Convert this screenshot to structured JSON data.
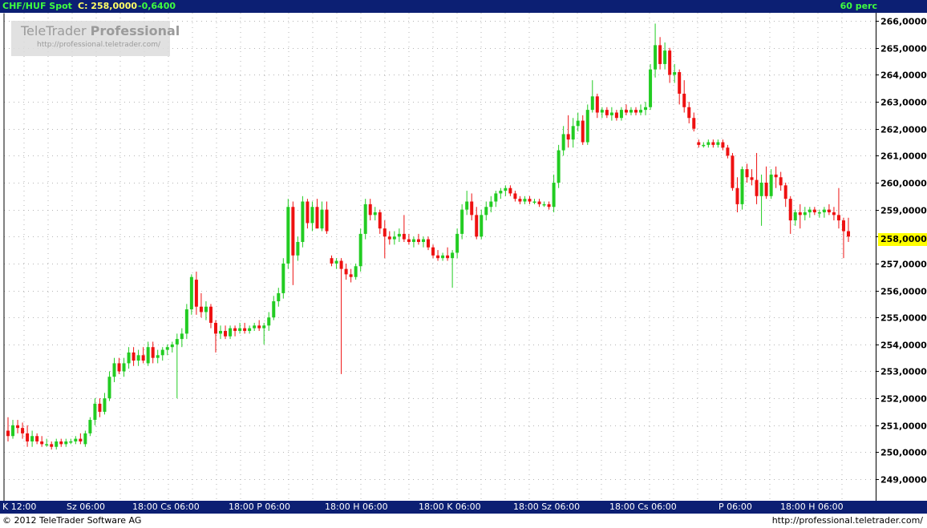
{
  "header": {
    "symbol": "CHF/HUF Spot",
    "close_label": "C: 258,0000",
    "change": "-0,6400",
    "interval": "60 perc"
  },
  "watermark": {
    "brand_light": "TeleTrader",
    "brand_bold": "Professional",
    "url": "http://professional.teletrader.com/"
  },
  "footer": {
    "copyright": "© 2012 TeleTrader Software AG",
    "url": "http://professional.teletrader.com/"
  },
  "colors": {
    "up": "#22cc22",
    "down": "#ee1111",
    "grid": "#b4b4b4",
    "header_bg": "#0c1f73",
    "last_price_bg": "#ffff00"
  },
  "chart_data": {
    "type": "candlestick",
    "y_axis_ticks": [
      "266,0000",
      "265,0000",
      "264,0000",
      "263,0000",
      "262,0000",
      "261,0000",
      "260,0000",
      "259,0000",
      "258,0000",
      "257,0000",
      "256,0000",
      "255,0000",
      "254,0000",
      "253,0000",
      "252,0000",
      "251,0000",
      "250,0000",
      "249,0000"
    ],
    "ylim": [
      248.2,
      266.3
    ],
    "last_price": 258.0,
    "last_price_label": "258,0000",
    "x_axis_ticks": [
      "K 12:00",
      "Sz 06:00",
      "18:00 Cs 06:00",
      "18:00 P 06:00",
      "18:00 H 06:00",
      "18:00 K 06:00",
      "18:00 Sz 06:00",
      "18:00 Cs 06:00",
      "P 06:00",
      "18:00 H 06:00"
    ],
    "candles": [
      [
        250.8,
        251.3,
        250.4,
        250.6
      ],
      [
        250.6,
        251.2,
        250.5,
        251.0
      ],
      [
        251.0,
        251.2,
        250.7,
        250.9
      ],
      [
        250.9,
        251.1,
        250.5,
        250.7
      ],
      [
        250.7,
        251.0,
        250.2,
        250.4
      ],
      [
        250.4,
        250.8,
        250.2,
        250.6
      ],
      [
        250.6,
        250.7,
        250.3,
        250.4
      ],
      [
        250.4,
        250.6,
        250.2,
        250.3
      ],
      [
        250.3,
        250.5,
        250.2,
        250.3
      ],
      [
        250.3,
        250.4,
        250.1,
        250.2
      ],
      [
        250.2,
        250.5,
        250.1,
        250.4
      ],
      [
        250.4,
        250.5,
        250.2,
        250.3
      ],
      [
        250.3,
        250.5,
        250.2,
        250.4
      ],
      [
        250.4,
        250.5,
        250.3,
        250.4
      ],
      [
        250.4,
        250.6,
        250.3,
        250.5
      ],
      [
        250.5,
        250.7,
        250.3,
        250.4
      ],
      [
        250.3,
        250.8,
        250.2,
        250.7
      ],
      [
        250.7,
        251.3,
        250.6,
        251.2
      ],
      [
        251.2,
        252.0,
        251.0,
        251.8
      ],
      [
        251.8,
        252.0,
        251.3,
        251.5
      ],
      [
        251.5,
        252.2,
        251.4,
        252.0
      ],
      [
        252.0,
        253.0,
        251.9,
        252.8
      ],
      [
        252.8,
        253.5,
        252.6,
        253.3
      ],
      [
        253.3,
        253.5,
        252.9,
        253.0
      ],
      [
        253.0,
        253.5,
        252.8,
        253.3
      ],
      [
        253.3,
        253.9,
        253.1,
        253.7
      ],
      [
        253.7,
        253.9,
        253.2,
        253.4
      ],
      [
        253.4,
        253.8,
        253.2,
        253.6
      ],
      [
        253.6,
        253.9,
        253.3,
        253.4
      ],
      [
        253.3,
        254.1,
        253.2,
        253.9
      ],
      [
        253.9,
        254.1,
        253.3,
        253.5
      ],
      [
        253.5,
        253.8,
        253.3,
        253.6
      ],
      [
        253.6,
        253.9,
        253.4,
        253.8
      ],
      [
        253.8,
        254.0,
        253.6,
        253.9
      ],
      [
        253.9,
        254.1,
        253.7,
        254.0
      ],
      [
        254.0,
        254.4,
        252.0,
        254.2
      ],
      [
        254.2,
        254.6,
        253.9,
        254.4
      ],
      [
        254.4,
        255.5,
        254.2,
        255.3
      ],
      [
        255.3,
        256.6,
        255.1,
        256.5
      ],
      [
        256.4,
        256.7,
        255.1,
        255.4
      ],
      [
        255.4,
        255.9,
        255.0,
        255.2
      ],
      [
        255.2,
        255.6,
        254.9,
        255.4
      ],
      [
        255.4,
        255.5,
        254.6,
        254.8
      ],
      [
        254.8,
        254.9,
        253.7,
        254.4
      ],
      [
        254.4,
        254.7,
        254.2,
        254.5
      ],
      [
        254.5,
        254.7,
        254.2,
        254.3
      ],
      [
        254.3,
        254.7,
        254.2,
        254.6
      ],
      [
        254.6,
        254.7,
        254.3,
        254.5
      ],
      [
        254.5,
        254.8,
        254.4,
        254.6
      ],
      [
        254.6,
        254.8,
        254.4,
        254.5
      ],
      [
        254.5,
        254.7,
        254.4,
        254.6
      ],
      [
        254.6,
        254.8,
        254.5,
        254.7
      ],
      [
        254.7,
        254.9,
        254.5,
        254.6
      ],
      [
        254.6,
        254.8,
        254.0,
        254.7
      ],
      [
        254.7,
        255.2,
        254.5,
        255.0
      ],
      [
        255.0,
        255.8,
        254.9,
        255.6
      ],
      [
        255.6,
        256.1,
        255.4,
        255.9
      ],
      [
        255.9,
        257.2,
        255.7,
        257.0
      ],
      [
        257.0,
        259.4,
        256.8,
        259.1
      ],
      [
        259.1,
        259.3,
        256.2,
        257.3
      ],
      [
        257.3,
        258.0,
        257.1,
        257.8
      ],
      [
        257.8,
        259.5,
        257.6,
        259.3
      ],
      [
        259.3,
        259.4,
        258.3,
        258.5
      ],
      [
        258.5,
        259.3,
        258.2,
        259.1
      ],
      [
        259.1,
        259.4,
        258.3,
        258.3
      ],
      [
        258.3,
        259.3,
        258.2,
        259.0
      ],
      [
        259.0,
        259.3,
        258.1,
        258.2
      ],
      [
        257.2,
        257.3,
        256.9,
        257.0
      ],
      [
        257.0,
        257.2,
        256.8,
        257.1
      ],
      [
        257.1,
        257.2,
        252.9,
        256.8
      ],
      [
        256.8,
        257.0,
        256.4,
        256.6
      ],
      [
        256.6,
        256.8,
        256.3,
        256.5
      ],
      [
        256.5,
        257.0,
        256.4,
        256.9
      ],
      [
        256.9,
        258.3,
        256.7,
        258.1
      ],
      [
        258.1,
        259.4,
        257.9,
        259.2
      ],
      [
        259.2,
        259.4,
        258.6,
        258.8
      ],
      [
        258.8,
        259.1,
        258.6,
        258.9
      ],
      [
        258.9,
        259.0,
        258.1,
        258.3
      ],
      [
        258.3,
        258.6,
        257.2,
        258.0
      ],
      [
        258.0,
        258.2,
        257.7,
        257.9
      ],
      [
        257.9,
        258.2,
        257.7,
        258.0
      ],
      [
        258.0,
        258.3,
        257.8,
        258.1
      ],
      [
        258.1,
        258.8,
        257.8,
        257.9
      ],
      [
        257.9,
        258.1,
        257.7,
        257.8
      ],
      [
        257.8,
        258.0,
        257.6,
        257.9
      ],
      [
        257.9,
        258.1,
        257.7,
        257.8
      ],
      [
        257.8,
        258.0,
        257.6,
        257.9
      ],
      [
        257.9,
        258.0,
        257.5,
        257.6
      ],
      [
        257.6,
        257.7,
        257.2,
        257.3
      ],
      [
        257.3,
        257.5,
        257.1,
        257.2
      ],
      [
        257.2,
        257.4,
        257.1,
        257.3
      ],
      [
        257.3,
        257.6,
        257.1,
        257.2
      ],
      [
        257.2,
        257.5,
        256.1,
        257.4
      ],
      [
        257.4,
        258.3,
        257.2,
        258.1
      ],
      [
        258.1,
        259.2,
        257.9,
        259.0
      ],
      [
        259.0,
        259.7,
        258.8,
        259.3
      ],
      [
        259.3,
        259.6,
        258.6,
        258.8
      ],
      [
        258.8,
        259.1,
        257.9,
        258.0
      ],
      [
        258.0,
        259.0,
        257.9,
        258.8
      ],
      [
        258.8,
        259.3,
        258.6,
        259.1
      ],
      [
        259.1,
        259.5,
        258.9,
        259.3
      ],
      [
        259.3,
        259.7,
        259.1,
        259.6
      ],
      [
        259.6,
        259.8,
        259.4,
        259.7
      ],
      [
        259.7,
        259.9,
        259.5,
        259.8
      ],
      [
        259.8,
        259.9,
        259.5,
        259.6
      ],
      [
        259.6,
        259.7,
        259.3,
        259.4
      ],
      [
        259.4,
        259.5,
        259.2,
        259.3
      ],
      [
        259.3,
        259.5,
        259.2,
        259.4
      ],
      [
        259.4,
        259.5,
        259.2,
        259.3
      ],
      [
        259.3,
        259.4,
        259.2,
        259.3
      ],
      [
        259.3,
        259.4,
        259.1,
        259.2
      ],
      [
        259.2,
        259.3,
        259.1,
        259.2
      ],
      [
        259.2,
        259.3,
        259.0,
        259.1
      ],
      [
        259.1,
        260.3,
        258.9,
        260.0
      ],
      [
        260.0,
        261.4,
        259.8,
        261.2
      ],
      [
        261.2,
        262.1,
        261.0,
        261.8
      ],
      [
        261.8,
        262.5,
        261.3,
        261.6
      ],
      [
        261.6,
        262.4,
        261.3,
        262.1
      ],
      [
        262.1,
        262.6,
        261.9,
        262.3
      ],
      [
        262.3,
        262.5,
        261.4,
        261.5
      ],
      [
        261.5,
        262.9,
        261.4,
        262.7
      ],
      [
        262.7,
        263.8,
        262.6,
        263.2
      ],
      [
        263.2,
        263.3,
        262.4,
        262.6
      ],
      [
        262.6,
        262.8,
        262.4,
        262.7
      ],
      [
        262.7,
        262.8,
        262.4,
        262.5
      ],
      [
        262.5,
        262.8,
        262.3,
        262.6
      ],
      [
        262.6,
        262.7,
        262.3,
        262.4
      ],
      [
        262.4,
        262.8,
        262.3,
        262.7
      ],
      [
        262.7,
        262.9,
        262.5,
        262.6
      ],
      [
        262.6,
        262.8,
        262.5,
        262.7
      ],
      [
        262.7,
        262.8,
        262.5,
        262.6
      ],
      [
        262.6,
        262.9,
        262.5,
        262.7
      ],
      [
        262.7,
        263.0,
        262.5,
        262.8
      ],
      [
        262.8,
        264.4,
        262.7,
        264.2
      ],
      [
        264.2,
        265.9,
        263.9,
        265.1
      ],
      [
        265.1,
        265.4,
        264.2,
        264.4
      ],
      [
        264.4,
        265.2,
        264.2,
        264.9
      ],
      [
        264.9,
        265.0,
        263.7,
        264.0
      ],
      [
        264.0,
        264.4,
        263.7,
        264.1
      ],
      [
        264.1,
        264.2,
        262.9,
        263.3
      ],
      [
        263.3,
        263.8,
        262.6,
        262.8
      ],
      [
        262.8,
        263.0,
        262.2,
        262.4
      ],
      [
        262.4,
        262.6,
        261.9,
        262.0
      ],
      [
        261.5,
        261.6,
        261.3,
        261.4
      ],
      [
        261.4,
        261.5,
        261.3,
        261.4
      ],
      [
        261.4,
        261.6,
        261.3,
        261.5
      ],
      [
        261.5,
        261.6,
        261.3,
        261.4
      ],
      [
        261.4,
        261.6,
        261.3,
        261.5
      ],
      [
        261.5,
        261.6,
        261.2,
        261.3
      ],
      [
        261.3,
        261.4,
        260.9,
        261.0
      ],
      [
        261.0,
        261.1,
        259.7,
        259.8
      ],
      [
        259.8,
        260.2,
        258.9,
        259.2
      ],
      [
        259.2,
        260.6,
        259.0,
        260.5
      ],
      [
        260.5,
        260.7,
        260.0,
        260.2
      ],
      [
        260.2,
        260.5,
        259.9,
        260.1
      ],
      [
        260.1,
        261.1,
        259.2,
        259.5
      ],
      [
        259.5,
        260.3,
        258.4,
        260.0
      ],
      [
        260.0,
        260.6,
        259.4,
        259.5
      ],
      [
        259.5,
        260.5,
        259.4,
        260.3
      ],
      [
        260.3,
        260.6,
        259.8,
        260.2
      ],
      [
        260.2,
        260.4,
        259.7,
        259.9
      ],
      [
        259.9,
        260.0,
        259.1,
        259.4
      ],
      [
        259.4,
        259.5,
        258.1,
        258.6
      ],
      [
        258.6,
        259.0,
        258.4,
        258.9
      ],
      [
        258.9,
        259.2,
        258.3,
        258.8
      ],
      [
        258.8,
        259.1,
        258.6,
        258.9
      ],
      [
        258.9,
        259.1,
        258.7,
        259.0
      ],
      [
        259.0,
        259.1,
        258.8,
        258.9
      ],
      [
        258.9,
        259.0,
        258.7,
        258.9
      ],
      [
        258.9,
        259.1,
        258.7,
        259.0
      ],
      [
        259.0,
        259.2,
        258.8,
        258.9
      ],
      [
        258.9,
        259.1,
        258.6,
        258.8
      ],
      [
        258.8,
        259.8,
        258.3,
        258.6
      ],
      [
        258.6,
        258.7,
        257.2,
        258.2
      ],
      [
        258.2,
        258.7,
        257.8,
        258.0
      ]
    ]
  }
}
